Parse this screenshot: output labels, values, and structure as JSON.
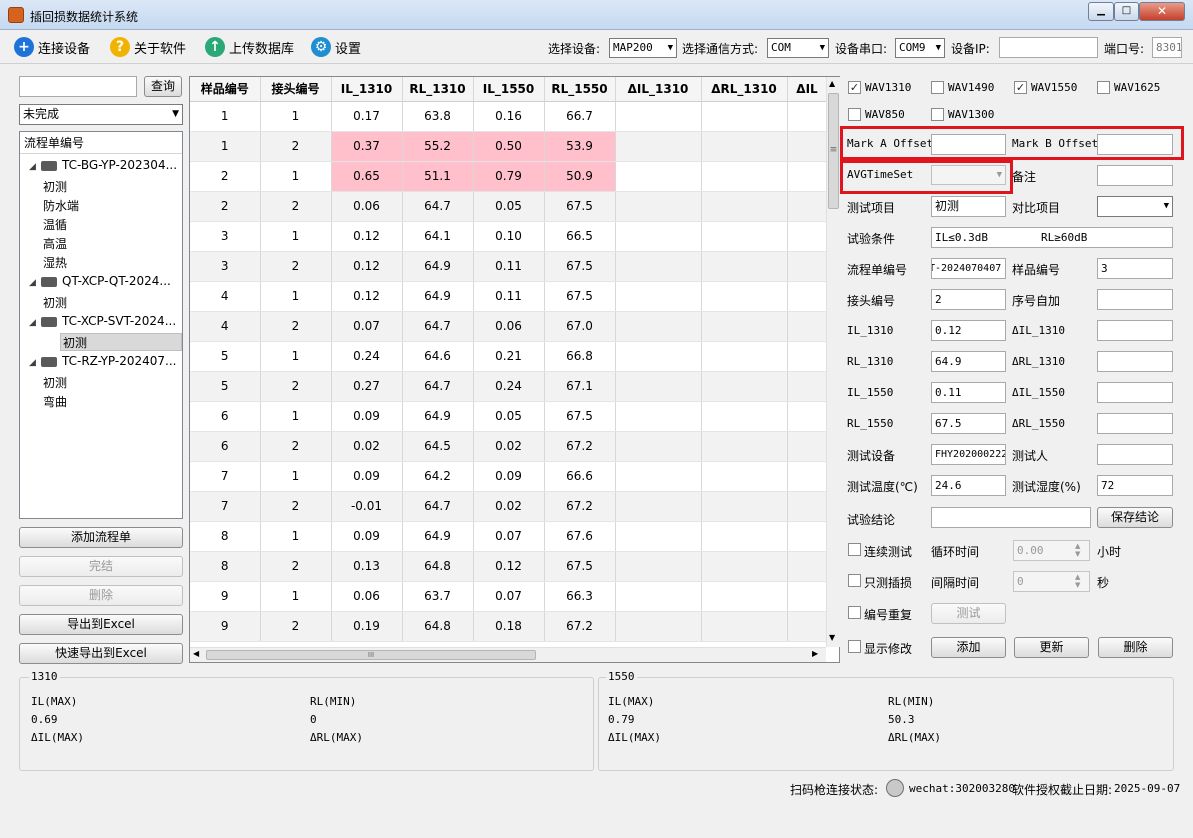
{
  "window": {
    "title": "插回损数据统计系统"
  },
  "toolbar": {
    "connect": "连接设备",
    "about": "关于软件",
    "upload": "上传数据库",
    "settings": "设置",
    "device_label": "选择设备:",
    "device_value": "MAP200",
    "comm_label": "选择通信方式:",
    "comm_value": "COM",
    "port_label": "设备串口:",
    "port_value": "COM9",
    "ip_label": "设备IP:",
    "ip_value": "",
    "portno_label": "端口号:",
    "portno_value": "8301"
  },
  "left": {
    "search_value": "",
    "query_btn": "查询",
    "status_value": "未完成",
    "tree_header": "流程单编号",
    "nodes": [
      {
        "label": "TC-BG-YP-202304...",
        "children": [
          "初测",
          "防水端",
          "温循",
          "高温",
          "湿热"
        ]
      },
      {
        "label": "QT-XCP-QT-2024...",
        "children": [
          "初测"
        ]
      },
      {
        "label": "TC-XCP-SVT-2024...",
        "children": [
          "初测"
        ]
      },
      {
        "label": "TC-RZ-YP-202407...",
        "children": [
          "初测",
          "弯曲"
        ]
      }
    ],
    "btn_add": "添加流程单",
    "btn_finish": "完结",
    "btn_delete": "删除",
    "btn_export": "导出到Excel",
    "btn_quick_export": "快速导出到Excel"
  },
  "table": {
    "headers": [
      "样品编号",
      "接头编号",
      "IL_1310",
      "RL_1310",
      "IL_1550",
      "RL_1550",
      "ΔIL_1310",
      "ΔRL_1310",
      "ΔIL"
    ],
    "rows": [
      [
        "1",
        "1",
        "0.17",
        "63.8",
        "0.16",
        "66.7"
      ],
      [
        "1",
        "2",
        "0.37",
        "55.2",
        "0.50",
        "53.9"
      ],
      [
        "2",
        "1",
        "0.65",
        "51.1",
        "0.79",
        "50.9"
      ],
      [
        "2",
        "2",
        "0.06",
        "64.7",
        "0.05",
        "67.5"
      ],
      [
        "3",
        "1",
        "0.12",
        "64.1",
        "0.10",
        "66.5"
      ],
      [
        "3",
        "2",
        "0.12",
        "64.9",
        "0.11",
        "67.5"
      ],
      [
        "4",
        "1",
        "0.12",
        "64.9",
        "0.11",
        "67.5"
      ],
      [
        "4",
        "2",
        "0.07",
        "64.7",
        "0.06",
        "67.0"
      ],
      [
        "5",
        "1",
        "0.24",
        "64.6",
        "0.21",
        "66.8"
      ],
      [
        "5",
        "2",
        "0.27",
        "64.7",
        "0.24",
        "67.1"
      ],
      [
        "6",
        "1",
        "0.09",
        "64.9",
        "0.05",
        "67.5"
      ],
      [
        "6",
        "2",
        "0.02",
        "64.5",
        "0.02",
        "67.2"
      ],
      [
        "7",
        "1",
        "0.09",
        "64.2",
        "0.09",
        "66.6"
      ],
      [
        "7",
        "2",
        "-0.01",
        "64.7",
        "0.02",
        "67.2"
      ],
      [
        "8",
        "1",
        "0.09",
        "64.9",
        "0.07",
        "67.6"
      ],
      [
        "8",
        "2",
        "0.13",
        "64.8",
        "0.12",
        "67.5"
      ],
      [
        "9",
        "1",
        "0.06",
        "63.7",
        "0.07",
        "66.3"
      ],
      [
        "9",
        "2",
        "0.19",
        "64.8",
        "0.18",
        "67.2"
      ]
    ],
    "hscroll_grip": "III",
    "vscroll_grip": "≡"
  },
  "right": {
    "wav": [
      "WAV1310",
      "WAV1490",
      "WAV1550",
      "WAV1625",
      "WAV850",
      "WAV1300"
    ],
    "wav_checked": [
      true,
      false,
      true,
      false,
      false,
      false
    ],
    "mark_a": "Mark A Offset",
    "mark_a_value": "",
    "mark_b": "Mark B Offset",
    "mark_b_value": "",
    "avg": "AVGTimeSet",
    "avg_value": "",
    "remark": "备注",
    "remark_value": "",
    "test_item": "测试项目",
    "test_item_value": "初测",
    "compare_item": "对比项目",
    "compare_value": "",
    "condition": "试验条件",
    "condition_value": "IL≤0.3dB        RL≥60dB",
    "flow_no": "流程单编号",
    "flow_no_value": "T-2024070407",
    "sample_no": "样品编号",
    "sample_no_value": "3",
    "connector_no": "接头编号",
    "connector_no_value": "2",
    "auto_inc": "序号自加",
    "auto_inc_value": "",
    "il1310": "IL_1310",
    "il1310_value": "0.12",
    "dil1310": "ΔIL_1310",
    "dil1310_value": "",
    "rl1310": "RL_1310",
    "rl1310_value": "64.9",
    "drl1310": "ΔRL_1310",
    "drl1310_value": "",
    "il1550": "IL_1550",
    "il1550_value": "0.11",
    "dil1550": "ΔIL_1550",
    "dil1550_value": "",
    "rl1550": "RL_1550",
    "rl1550_value": "67.5",
    "drl1550": "ΔRL_1550",
    "drl1550_value": "",
    "device": "测试设备",
    "device_value": "FHY202000222",
    "tester": "测试人",
    "tester_value": "",
    "temp": "测试温度(℃)",
    "temp_value": "24.6",
    "humid": "测试湿度(%)",
    "humid_value": "72",
    "conclusion": "试验结论",
    "conclusion_value": "",
    "save_conclusion": "保存结论",
    "continuous": "连续测试",
    "cycle_time": "循环时间",
    "cycle_value": "0.00",
    "hour": "小时",
    "il_only": "只测插损",
    "interval": "间隔时间",
    "interval_value": "0",
    "sec": "秒",
    "dup": "编号重复",
    "test_btn": "测试",
    "show_mod": "显示修改",
    "add_btn": "添加",
    "update_btn": "更新",
    "delete_btn": "删除"
  },
  "summary": {
    "g1310": {
      "title": "1310",
      "il_max_label": "IL(MAX)",
      "il_max": "0.69",
      "rl_min_label": "RL(MIN)",
      "rl_min": "0",
      "dil_label": "ΔIL(MAX)",
      "drl_label": "ΔRL(MAX)"
    },
    "g1550": {
      "title": "1550",
      "il_max_label": "IL(MAX)",
      "il_max": "0.79",
      "rl_min_label": "RL(MIN)",
      "rl_min": "50.3",
      "dil_label": "ΔIL(MAX)",
      "drl_label": "ΔRL(MAX)"
    }
  },
  "status": {
    "scanner_label": "扫码枪连接状态:",
    "wechat": "wechat:302003280",
    "license_label": "软件授权截止日期:",
    "license_date": "2025-09-07"
  },
  "colors": {
    "highlight": "#ffc0cb",
    "red_box": "#e0141e",
    "connect_icon": "#1e73d8",
    "about_icon": "#f0b400",
    "upload_icon": "#2aa876",
    "settings_icon": "#1e8fd0"
  }
}
